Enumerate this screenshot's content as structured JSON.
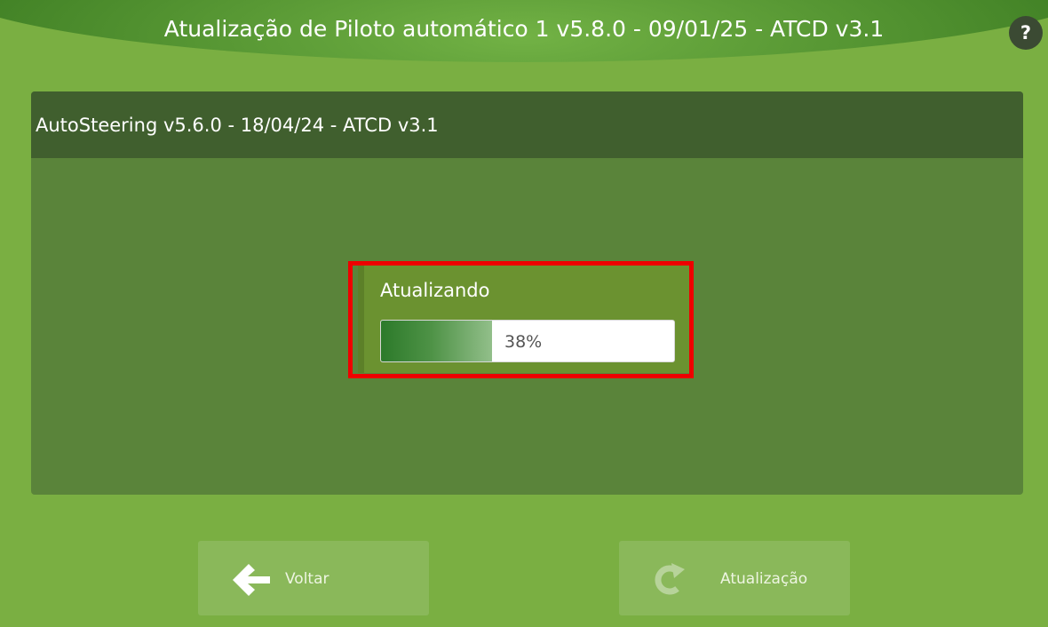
{
  "header": {
    "title": "Atualização de Piloto automático 1 v5.8.0 - 09/01/25 - ATCD v3.1",
    "help_label": "?"
  },
  "panel": {
    "title": "AutoSteering v5.6.0 - 18/04/24 - ATCD v3.1"
  },
  "progress_dialog": {
    "label": "Atualizando",
    "value_text": "38%",
    "fraction": 0.38
  },
  "footer": {
    "back_label": "Voltar",
    "back_icon": "arrow-left-icon",
    "update_label": "Atualização",
    "update_icon": "refresh-icon"
  },
  "colors": {
    "background": "#7aaf42",
    "panel": "#5a843a",
    "panel_header": "#405f2e",
    "highlight": "#ee0000",
    "progress_fill": "#2c7a2a"
  }
}
